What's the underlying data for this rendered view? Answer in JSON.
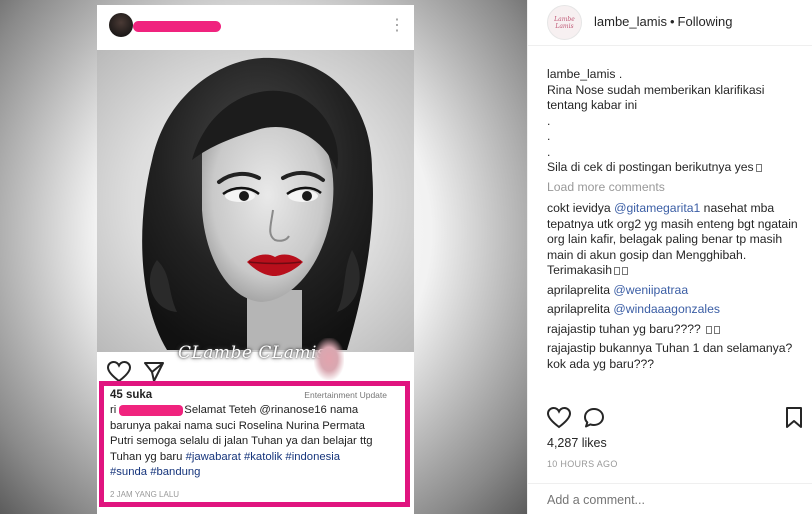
{
  "photo": {
    "watermark": "CLambe CLamis",
    "menu_glyph": "⋮",
    "caption": {
      "likes": "45 suka",
      "tag": "Entertainment Update",
      "line1_user": "ri",
      "line1_rest": "Selamat Teteh @rinanose16 nama",
      "line2": "barunya pakai nama suci Roselina Nurina Permata",
      "line3": "Putri semoga selalu di jalan Tuhan ya dan belajar ttg",
      "line4_pre": "Tuhan yg baru ",
      "line4_tags": "#jawabarat #katolik #indonesia",
      "line5_tags": "#sunda #bandung",
      "time": "2 JAM YANG LALU"
    }
  },
  "sidebar": {
    "avatar_text": "Lambe Lamis",
    "username": "lambe_lamis",
    "separator": "•",
    "follow_status": "Following",
    "post": {
      "user": "lambe_lamis",
      "after_user": ".",
      "line1": "Rina Nose sudah memberikan klarifikasi",
      "line2": "tentang kabar ini",
      "dot1": ".",
      "dot2": ".",
      "dot3": ".",
      "line3": "Sila di cek di postingan berikutnya yes"
    },
    "load_more": "Load more comments",
    "comments": [
      {
        "user": "cokt ievidya",
        "mention": "@gitamegarita1",
        "text": " nasehat mba tepatnya utk org2 yg masih enteng bgt ngatain org lain kafir, belagak paling benar tp masih main di akun gosip dan Mengghibah. Terimakasih"
      },
      {
        "user": "aprilaprelita",
        "mention": "@weniipatraa",
        "text": ""
      },
      {
        "user": "aprilaprelita",
        "mention": "@windaaagonzales",
        "text": ""
      },
      {
        "user": "rajajastip",
        "mention": "",
        "text": " tuhan yg baru???? "
      },
      {
        "user": "rajajastip",
        "mention": "",
        "text": " bukannya Tuhan 1 dan selamanya? kok ada yg baru???"
      }
    ],
    "likes": "4,287 likes",
    "time": "10 HOURS AGO",
    "comment_placeholder": "Add a comment..."
  },
  "colors": {
    "redaction_pink": "#f0237e",
    "caption_border": "#e0147f",
    "mention_blue": "#3b5ea5",
    "hashtag_blue": "#16357c"
  },
  "icons": [
    "heart-icon",
    "comment-icon",
    "share-icon",
    "bookmark-icon",
    "more-icon"
  ]
}
